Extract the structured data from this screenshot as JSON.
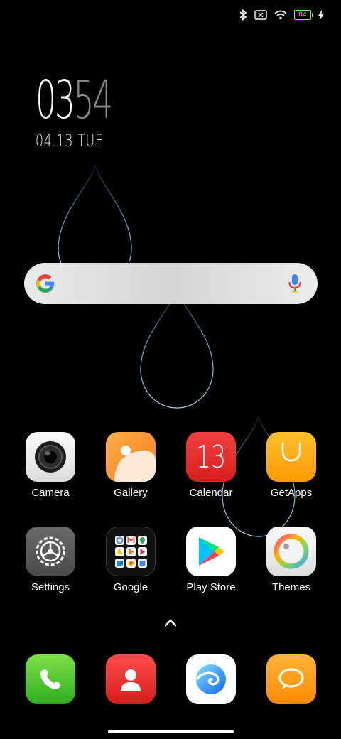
{
  "status_bar": {
    "battery_level": "84",
    "icons": [
      "bluetooth-icon",
      "sim-absent-icon",
      "wifi-icon",
      "battery-icon",
      "charging-icon"
    ],
    "accent": "#7ef06b"
  },
  "clock": {
    "hours": "03",
    "minutes": "54",
    "date": "04.13 TUE"
  },
  "search": {
    "brand": "google-logo",
    "mic": "microphone-icon"
  },
  "apps": [
    {
      "label": "Camera",
      "icon": "camera-icon"
    },
    {
      "label": "Gallery",
      "icon": "gallery-icon"
    },
    {
      "label": "Calendar",
      "icon": "calendar-icon",
      "day": "13"
    },
    {
      "label": "GetApps",
      "icon": "getapps-icon"
    },
    {
      "label": "Settings",
      "icon": "settings-icon"
    },
    {
      "label": "Google",
      "icon": "google-folder-icon"
    },
    {
      "label": "Play Store",
      "icon": "play-store-icon"
    },
    {
      "label": "Themes",
      "icon": "themes-icon"
    }
  ],
  "dock": [
    "phone-icon",
    "contacts-icon",
    "browser-icon",
    "messages-icon"
  ]
}
